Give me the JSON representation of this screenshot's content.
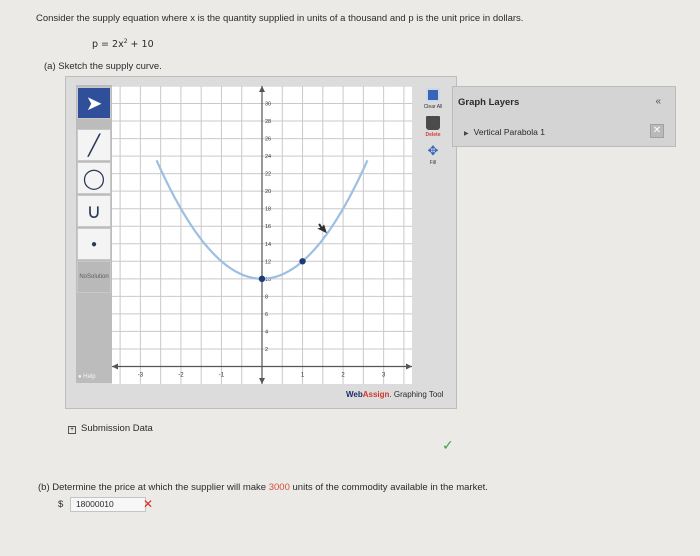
{
  "question": {
    "text": "Consider the supply equation where x is the quantity supplied in units of a thousand and p is the unit price in dollars.",
    "equation_left": "p = 2x",
    "equation_exp": "2",
    "equation_right": " + 10",
    "part_a": "(a)  Sketch the supply curve.",
    "part_b_prefix": "(b)  Determine the price at which the supplier will make ",
    "part_b_highlight": "3000",
    "part_b_suffix": " units of the commodity available in the market."
  },
  "tool": {
    "no_solution_label": [
      "No",
      "Solution"
    ],
    "help_label": "Help",
    "clear_all_label": "Clear All",
    "delete_label": "Delete",
    "fill_label": "Fill",
    "brand_web": "Web",
    "brand_assign": "Assign",
    "brand_suffix": ". Graphing Tool"
  },
  "graph": {
    "x_ticks": [
      "-3",
      "-2",
      "-1",
      "1",
      "2",
      "3"
    ],
    "y_ticks": [
      "2",
      "4",
      "6",
      "8",
      "10",
      "12",
      "14",
      "16",
      "18",
      "20",
      "22",
      "24",
      "26",
      "28",
      "30"
    ],
    "curve_color": "#9dbfe3",
    "point_color": "#1f3b73",
    "vertex": {
      "x": 0,
      "y": 10
    },
    "point": {
      "x": 1,
      "y": 12
    },
    "arrow": {
      "x": 1.6,
      "y": 15.2
    }
  },
  "layers": {
    "title": "Graph Layers",
    "collapse": "«",
    "item": "Vertical Parabola 1",
    "delete": "✕"
  },
  "submission": {
    "label": "Submission Data",
    "icon": "+"
  },
  "answer": {
    "currency": "$",
    "value": "18000010"
  },
  "colors": {
    "highlight": "#d24f37",
    "wrong": "#dc2a2a",
    "correct": "#43a047",
    "active_tool": "#2f4f9a"
  }
}
